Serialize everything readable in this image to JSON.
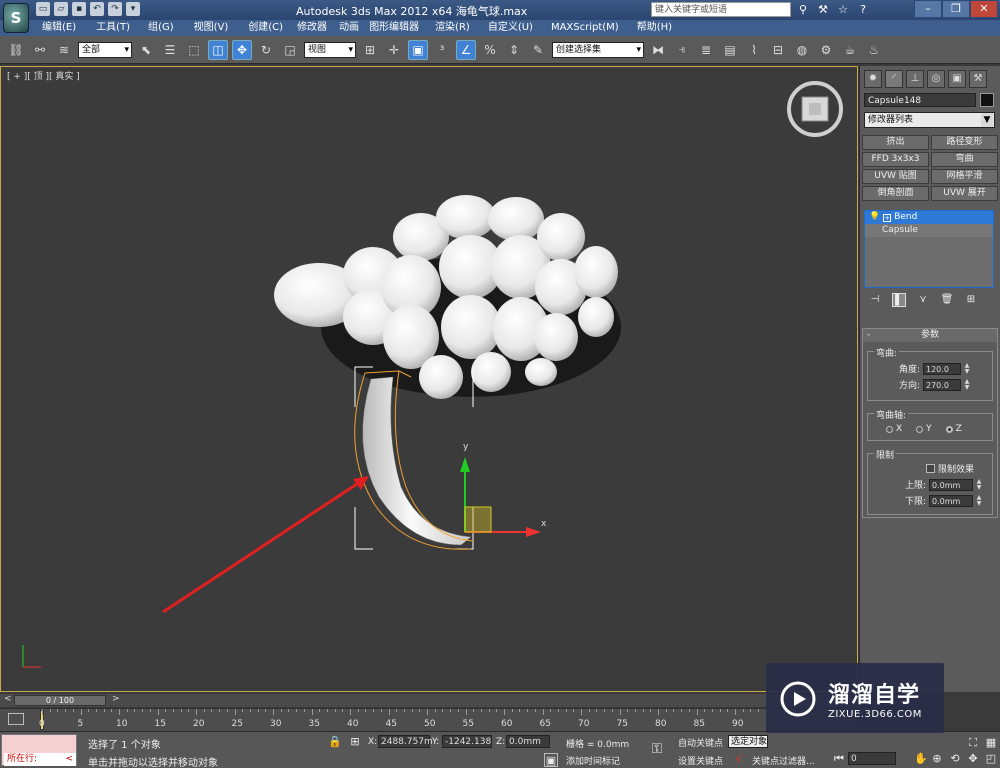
{
  "app": {
    "logo_letter": "S",
    "title": "Autodesk 3ds Max  2012 x64      海龟气球.max",
    "search_placeholder": "键入关键字或短语"
  },
  "menu": [
    "编辑(E)",
    "工具(T)",
    "组(G)",
    "视图(V)",
    "创建(C)",
    "修改器",
    "动画",
    "图形编辑器",
    "渲染(R)",
    "自定义(U)",
    "MAXScript(M)",
    "帮助(H)"
  ],
  "toolbar": {
    "selection_filter": "全部",
    "ref_coord": "视图",
    "named_selection": "创建选择集"
  },
  "viewport": {
    "label": "[ + ][ 顶 ][ 真实 ]",
    "gizmo_x": "x",
    "gizmo_y": "y"
  },
  "command_panel": {
    "object_name": "Capsule148",
    "modifier_list": "修改器列表",
    "modifier_buttons": [
      "挤出",
      "路径变形",
      "FFD 3x3x3",
      "弯曲",
      "UVW 贴图",
      "网格平滑",
      "倒角剖面",
      "UVW 展开"
    ],
    "stack": [
      {
        "name": "Bend",
        "selected": true
      },
      {
        "name": "Capsule",
        "selected": false
      }
    ],
    "params": {
      "rollout_title": "参数",
      "minus": "-",
      "bend_group": "弯曲:",
      "angle_label": "角度:",
      "angle_value": "120.0",
      "direction_label": "方向:",
      "direction_value": "270.0",
      "axis_group": "弯曲轴:",
      "axes": [
        "X",
        "Y",
        "Z"
      ],
      "axis_selected": "Z",
      "limits_group": "限制",
      "limit_effect": "限制效果",
      "upper_label": "上限:",
      "upper_value": "0.0mm",
      "lower_label": "下限:",
      "lower_value": "0.0mm"
    }
  },
  "timeline": {
    "frame": "0 / 100",
    "prev": "<",
    "next": ">",
    "ticks": [
      "0",
      "5",
      "10",
      "15",
      "20",
      "25",
      "30",
      "35",
      "40",
      "45",
      "50",
      "55",
      "60",
      "65",
      "70",
      "75",
      "80",
      "85",
      "90"
    ]
  },
  "status": {
    "script_line": "所在行:",
    "script_lt": "<",
    "selected_text": "选择了 1 个对象",
    "prompt_text": "单击并拖动以选择并移动对象",
    "x_label": "X:",
    "x_value": "2488.757m",
    "y_label": "Y:",
    "y_value": "-1242.138",
    "z_label": "Z:",
    "z_value": "0.0mm",
    "grid": "栅格 = 0.0mm",
    "add_time_tag": "添加时间标记",
    "auto_key": "自动关键点",
    "selected_obj": "选定对象",
    "set_key": "设置关键点",
    "key_filters": "关键点过滤器...",
    "frame_value": "0"
  },
  "watermark": {
    "title": "溜溜自学",
    "url": "ZIXUE.3D66.COM"
  },
  "colors": {
    "accent": "#2f7ad6",
    "arrow": "#e02020",
    "selection": "#f0a030"
  }
}
